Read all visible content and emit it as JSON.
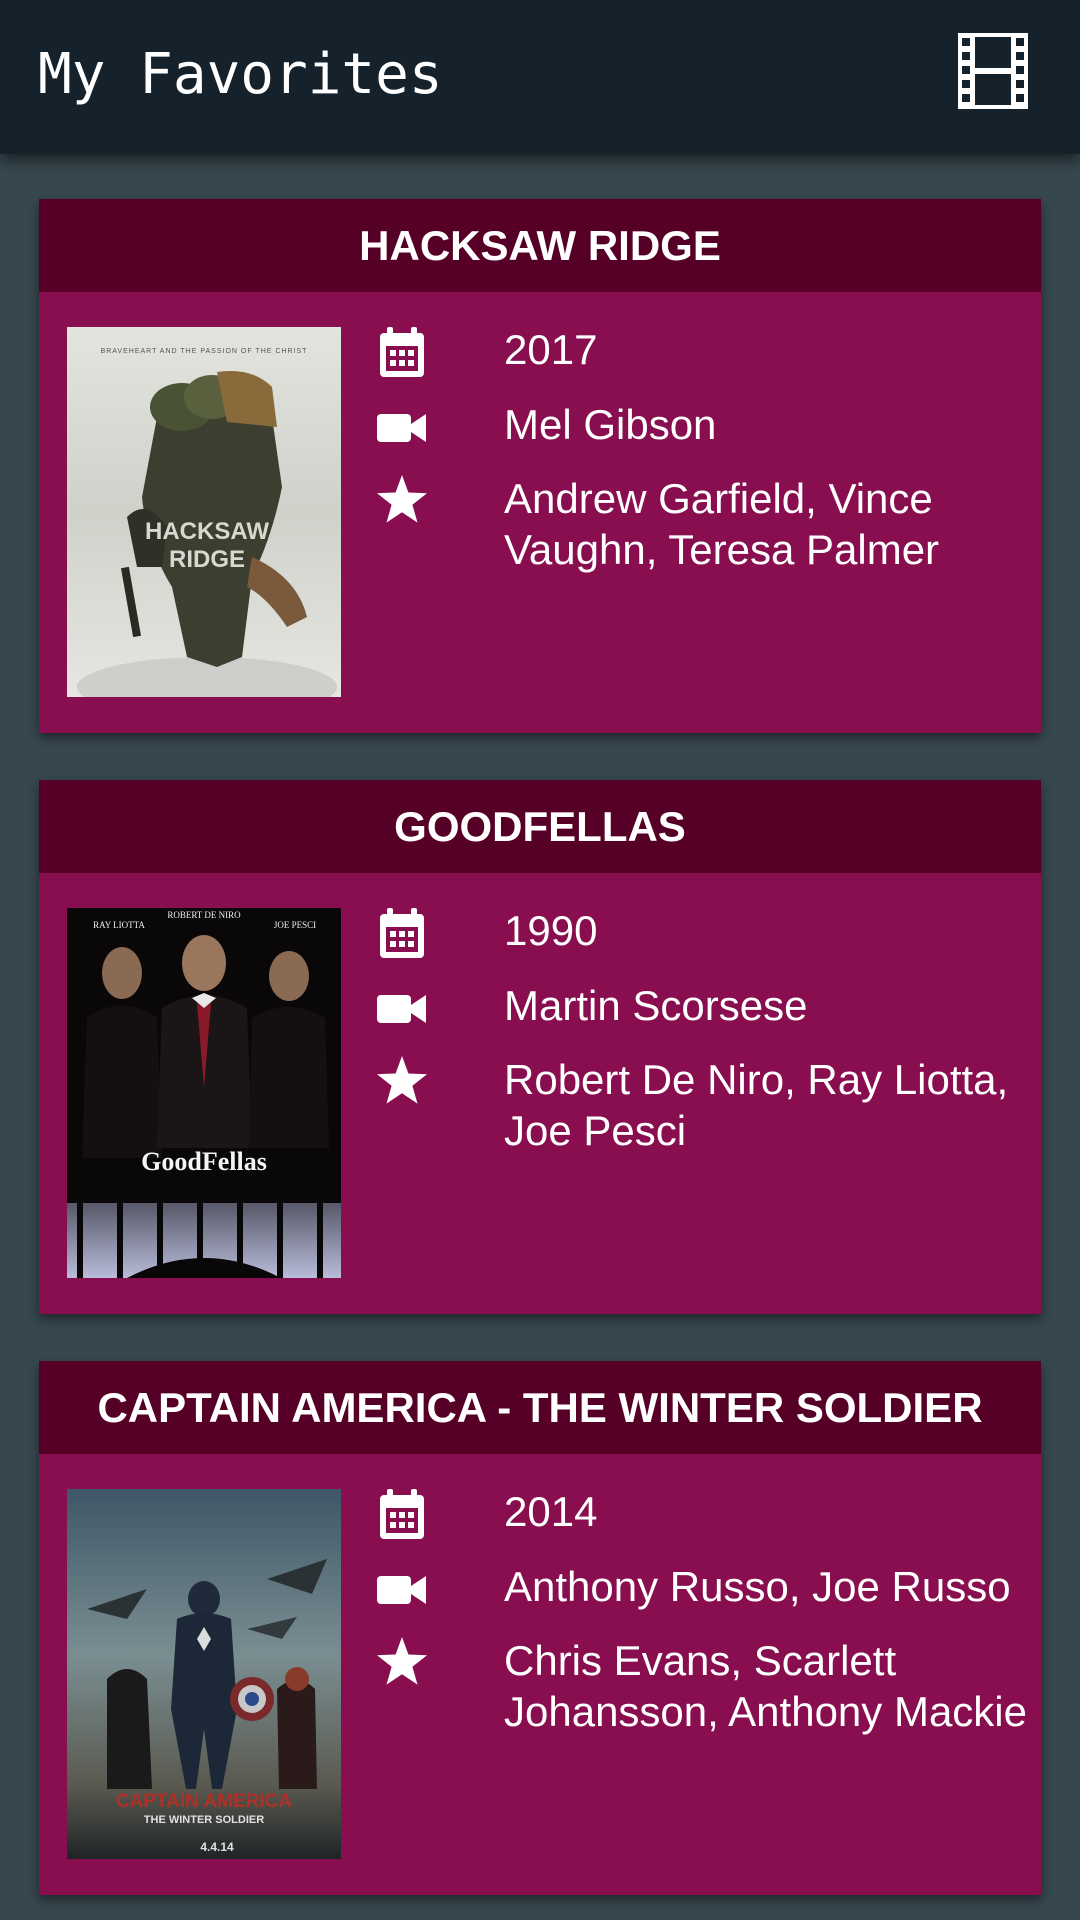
{
  "app_bar": {
    "title": "My Favorites",
    "action_icon": "film-icon"
  },
  "colors": {
    "app_bar": "#15212b",
    "background": "#37474f",
    "card": "#880e4f",
    "card_header": "#560027",
    "text": "#ffffff"
  },
  "movies": [
    {
      "title": "HACKSAW RIDGE",
      "year": "2017",
      "director": "Mel Gibson",
      "cast": "Andrew Garfield, Vince Vaughn, Teresa Palmer",
      "poster": {
        "top_line": "BRAVEHEART AND THE PASSION OF THE CHRIST",
        "title_line1": "HACKSAW",
        "title_line2": "RIDGE"
      }
    },
    {
      "title": "GOODFELLAS",
      "year": "1990",
      "director": "Martin Scorsese",
      "cast": "Robert De Niro, Ray Liotta, Joe Pesci",
      "poster": {
        "name_left": "RAY LIOTTA",
        "name_center": "ROBERT DE NIRO",
        "name_right": "JOE PESCI",
        "title": "GoodFellas"
      }
    },
    {
      "title": "CAPTAIN AMERICA - THE WINTER SOLDIER",
      "year": "2014",
      "director": "Anthony Russo, Joe Russo",
      "cast": "Chris Evans, Scarlett Johansson, Anthony Mackie",
      "poster": {
        "title_line1": "CAPTAIN AMERICA",
        "title_line2": "THE WINTER SOLDIER",
        "date": "4.4.14"
      }
    }
  ],
  "icons": {
    "year": "calendar-icon",
    "director": "video-camera-icon",
    "cast": "star-icon"
  }
}
